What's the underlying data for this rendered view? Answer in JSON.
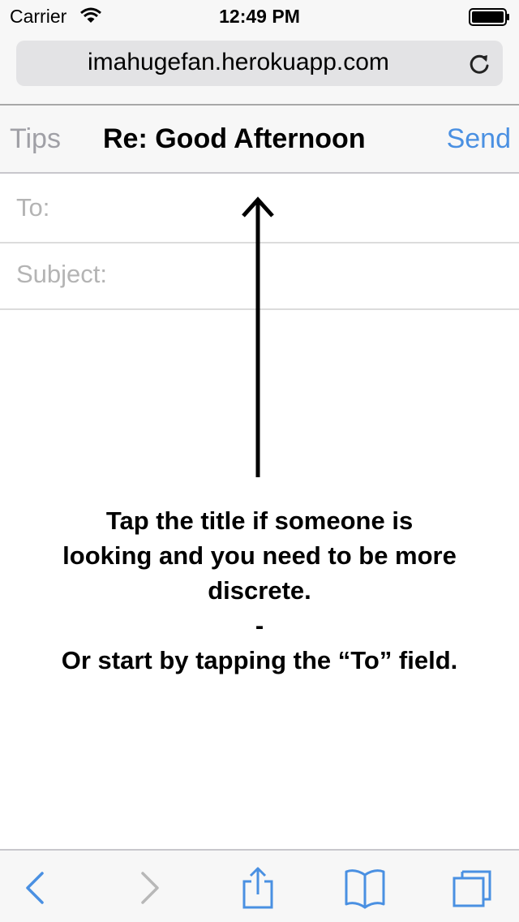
{
  "status_bar": {
    "carrier": "Carrier",
    "time": "12:49 PM"
  },
  "browser": {
    "url": "imahugefan.herokuapp.com"
  },
  "compose": {
    "tips_label": "Tips",
    "title": "Re: Good Afternoon",
    "send_label": "Send",
    "to_label": "To:",
    "subject_label": "Subject:"
  },
  "instructions": {
    "line1": "Tap the title if someone is",
    "line2": "looking and you need to be more",
    "line3": "discrete.",
    "separator": "-",
    "line4": "Or start by tapping the “To” field."
  },
  "toolbar": {
    "icons": [
      "back-icon",
      "forward-icon",
      "share-icon",
      "bookmarks-icon",
      "tabs-icon"
    ]
  },
  "colors": {
    "accent": "#4a90e2",
    "disabled": "#b8b8b8",
    "placeholder": "#b4b4b4",
    "bar_background": "#f7f7f7"
  }
}
